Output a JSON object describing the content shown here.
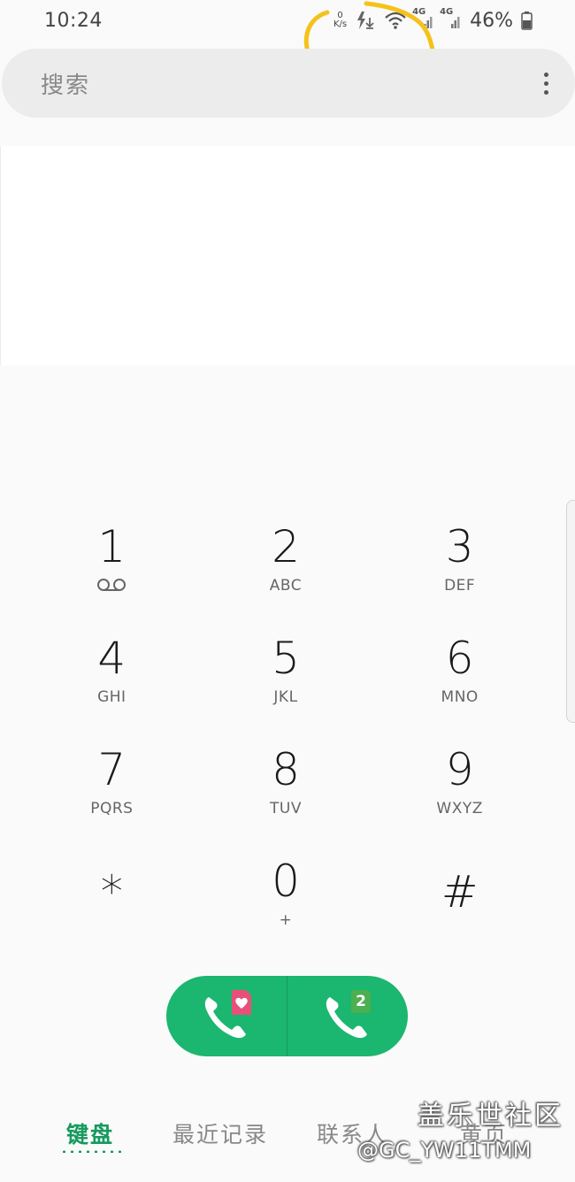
{
  "status_bar": {
    "time": "10:24",
    "net_speed_value": "0",
    "net_speed_unit": "K/s",
    "sim1_network": "4G",
    "sim2_network": "4G",
    "battery_percent": "46%"
  },
  "search": {
    "placeholder": "搜索"
  },
  "keypad": {
    "keys": [
      {
        "digit": "1",
        "letters": ""
      },
      {
        "digit": "2",
        "letters": "ABC"
      },
      {
        "digit": "3",
        "letters": "DEF"
      },
      {
        "digit": "4",
        "letters": "GHI"
      },
      {
        "digit": "5",
        "letters": "JKL"
      },
      {
        "digit": "6",
        "letters": "MNO"
      },
      {
        "digit": "7",
        "letters": "PQRS"
      },
      {
        "digit": "8",
        "letters": "TUV"
      },
      {
        "digit": "9",
        "letters": "WXYZ"
      },
      {
        "digit": "*",
        "letters": ""
      },
      {
        "digit": "0",
        "letters": "+"
      },
      {
        "digit": "#",
        "letters": ""
      }
    ]
  },
  "call": {
    "sim2_label": "2",
    "accent_color": "#1bb66f"
  },
  "tabs": [
    {
      "label": "键盘",
      "active": true
    },
    {
      "label": "最近记录",
      "active": false
    },
    {
      "label": "联系人",
      "active": false
    },
    {
      "label": "黄页",
      "active": false
    }
  ],
  "watermark": {
    "title": "盖乐世社区",
    "handle": "@GC_YW11TMM"
  },
  "icons": [
    "voicemail-icon",
    "wifi-icon",
    "signal-icon",
    "battery-icon",
    "more-vert-icon",
    "phone-icon",
    "heart-sim-icon",
    "sim-2-icon"
  ]
}
